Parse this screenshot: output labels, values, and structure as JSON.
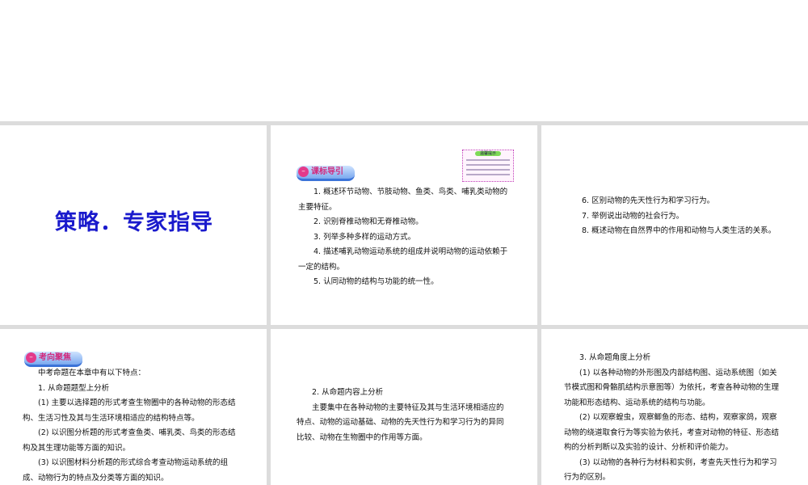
{
  "slides": [
    {
      "title": "策略．专家指导"
    },
    {
      "tag": "课标导引",
      "note_title": "温馨提示",
      "lines": [
        "1. 概述环节动物、节肢动物、鱼类、鸟类、哺乳类动物的主要特征。",
        "2. 识别脊椎动物和无脊椎动物。",
        "3. 列举多种多样的运动方式。",
        "4. 描述哺乳动物运动系统的组成并说明动物的运动依赖于一定的结构。",
        "5. 认同动物的结构与功能的统一性。"
      ]
    },
    {
      "lines": [
        "6. 区别动物的先天性行为和学习行为。",
        "7. 举例说出动物的社会行为。",
        "8. 概述动物在自然界中的作用和动物与人类生活的关系。"
      ]
    },
    {
      "tag": "考向聚焦",
      "lines": [
        "中考命题在本章中有以下特点：",
        "1. 从命题题型上分析",
        "(1) 主要以选择题的形式考查生物圈中的各种动物的形态结构、生活习性及其与生活环境相适应的结构特点等。",
        "(2) 以识图分析题的形式考查鱼类、哺乳类、鸟类的形态结构及其生理功能等方面的知识。",
        "(3) 以识图材料分析题的形式综合考查动物运动系统的组成、动物行为的特点及分类等方面的知识。"
      ]
    },
    {
      "lines": [
        "2. 从命题内容上分析",
        "主要集中在各种动物的主要特征及其与生活环境相适应的特点、动物的运动基础、动物的先天性行为和学习行为的异同比较、动物在生物圈中的作用等方面。"
      ]
    },
    {
      "lines": [
        "3. 从命题角度上分析",
        "(1) 以各种动物的外形图及内部结构图、运动系统图（如关节模式图和骨骼肌结构示意图等）为依托，考查各种动物的生理功能和形态结构、运动系统的结构与功能。",
        "(2) 以观察蝗虫，观察鲫鱼的形态、结构，观察家鸽，观察动物的绕道取食行为等实验为依托，考查对动物的特征、形态结构的分析判断以及实验的设计、分析和评价能力。",
        "(3) 以动物的各种行为材料和实例，考查先天性行为和学习行为的区别。"
      ]
    }
  ]
}
